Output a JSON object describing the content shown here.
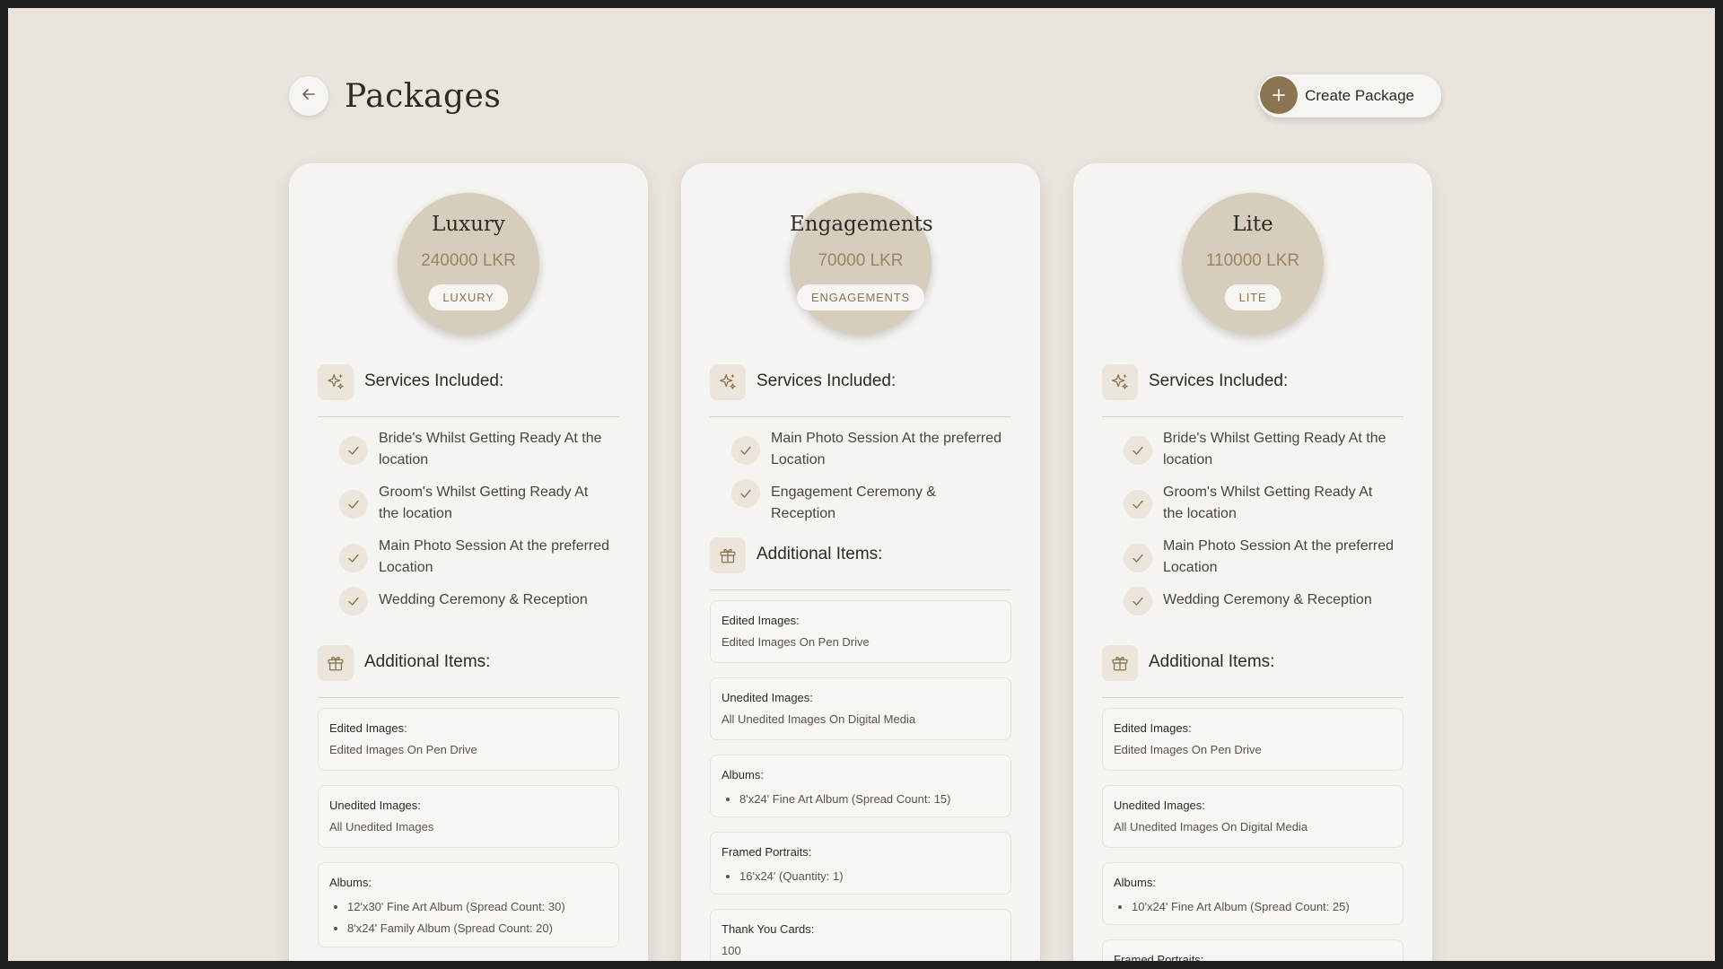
{
  "header": {
    "title": "Packages",
    "create_label": "Create Package"
  },
  "sections": {
    "services_title": "Services Included:",
    "additional_title": "Additional Items:"
  },
  "packages": [
    {
      "name": "Luxury",
      "price": "240000 LKR",
      "tag": "LUXURY",
      "services": [
        "Bride's Whilst Getting Ready At the location",
        "Groom's Whilst Getting Ready At the location",
        "Main Photo Session At the preferred Location",
        "Wedding Ceremony & Reception"
      ],
      "items": [
        {
          "label": "Edited Images:",
          "value": "Edited Images On Pen Drive"
        },
        {
          "label": "Unedited Images:",
          "value": "All Unedited Images"
        },
        {
          "label": "Albums:",
          "list": [
            "12'x30' Fine Art Album (Spread Count: 30)",
            "8'x24' Family Album (Spread Count: 20)"
          ]
        }
      ]
    },
    {
      "name": "Engagements",
      "price": "70000 LKR",
      "tag": "ENGAGEMENTS",
      "services": [
        "Main Photo Session At the preferred Location",
        "Engagement Ceremony & Reception"
      ],
      "items": [
        {
          "label": "Edited Images:",
          "value": "Edited Images On Pen Drive"
        },
        {
          "label": "Unedited Images:",
          "value": "All Unedited Images On Digital Media"
        },
        {
          "label": "Albums:",
          "list": [
            "8'x24' Fine Art Album (Spread Count: 15)"
          ]
        },
        {
          "label": "Framed Portraits:",
          "list": [
            "16'x24' (Quantity: 1)"
          ]
        },
        {
          "label": "Thank You Cards:",
          "value": "100"
        }
      ]
    },
    {
      "name": "Lite",
      "price": "110000 LKR",
      "tag": "LITE",
      "services": [
        "Bride's Whilst Getting Ready At the location",
        "Groom's Whilst Getting Ready At the location",
        "Main Photo Session At the preferred Location",
        "Wedding Ceremony & Reception"
      ],
      "items": [
        {
          "label": "Edited Images:",
          "value": "Edited Images On Pen Drive"
        },
        {
          "label": "Unedited Images:",
          "value": "All Unedited Images On Digital Media"
        },
        {
          "label": "Albums:",
          "list": [
            "10'x24' Fine Art Album (Spread Count: 25)"
          ]
        },
        {
          "label": "Framed Portraits:"
        }
      ]
    }
  ],
  "icons": {
    "back": "arrow-left-icon",
    "create": "plus-icon",
    "services": "sparkles-icon",
    "additional": "gift-icon",
    "check": "check-icon"
  },
  "colors": {
    "background": "#e9e4dd",
    "card": "#f6f4f0",
    "accent": "#8b7452",
    "price_circle": "#d6cdbd",
    "price_text": "#9b8565"
  }
}
